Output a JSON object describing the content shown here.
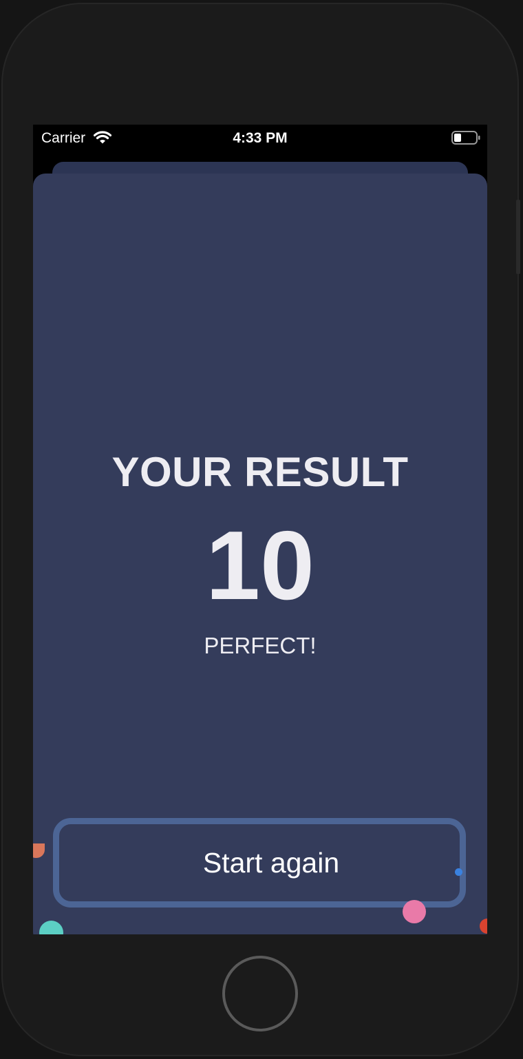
{
  "status_bar": {
    "carrier": "Carrier",
    "time": "4:33 PM",
    "icons": [
      "wifi-icon",
      "battery-icon"
    ]
  },
  "result": {
    "title": "YOUR RESULT",
    "score": "10",
    "rating": "PERFECT!"
  },
  "actions": {
    "start_again_label": "Start again"
  },
  "colors": {
    "card_background": "#343c5b",
    "card_back_background": "#2c3554",
    "button_border": "#4c6595",
    "text": "#eeedf2",
    "confetti": [
      "#d9775b",
      "#5ccfc4",
      "#e97aa8",
      "#3a82e0",
      "#d9432f"
    ]
  }
}
